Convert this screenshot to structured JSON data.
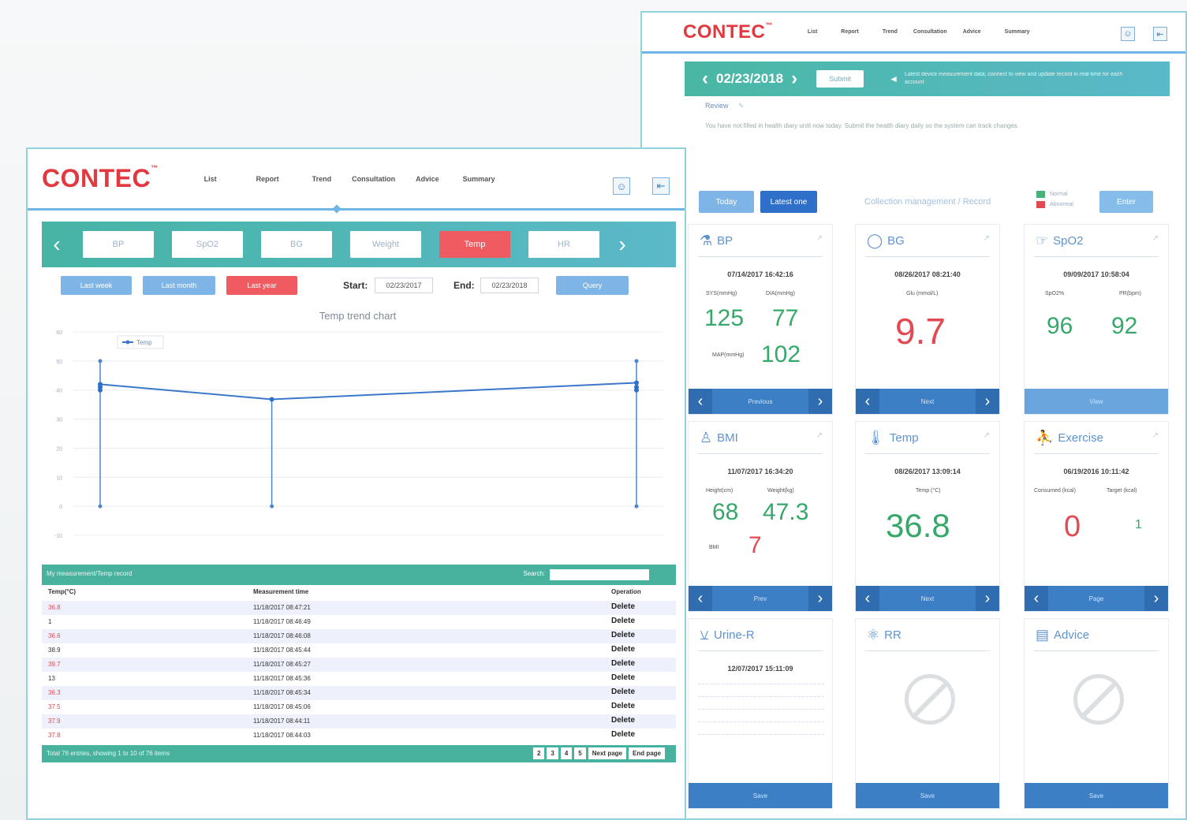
{
  "brand": {
    "logo": "CONTEC",
    "tm": "™",
    "logo_color": "#e2383f"
  },
  "colors": {
    "teal": "#49b29f",
    "accent_blue": "#2d6fc9",
    "red_value": "#e14a52",
    "green_value": "#35a86a",
    "active_tab": "#ef5b60"
  },
  "right_window": {
    "nav": [
      "List",
      "Report",
      "Trend",
      "Consultation",
      "Advice",
      "Summary"
    ],
    "header_icons": [
      "user-icon",
      "logout-icon"
    ],
    "date_bar": {
      "prev": "‹",
      "date": "02/23/2018",
      "next": "›",
      "button": "Submit",
      "note": "Latest device measurement data; connect to view and update record in real-time for each account"
    },
    "review": {
      "label": "Review",
      "text": "You have not filled in health diary until now today. Submit the health diary daily so the system can track changes."
    },
    "buttons": {
      "today": "Today",
      "latest": "Latest one",
      "collect": "Collection management / Record",
      "enter": "Enter"
    },
    "legend": [
      "Normal",
      "Abnormal"
    ],
    "cards": [
      {
        "title": "BP",
        "icon": "blood-pressure-icon",
        "timestamp": "07/14/2017 16:42:16",
        "labels": [
          "SYS(mmHg)",
          "DIA(mmHg)",
          "MAP(mmHg)"
        ],
        "values": [
          "125",
          "77",
          "102"
        ],
        "nav": "Previous"
      },
      {
        "title": "BG",
        "icon": "blood-glucose-icon",
        "timestamp": "08/26/2017 08:21:40",
        "labels": [
          "Glu (mmol/L)"
        ],
        "values": [
          "9.7"
        ],
        "nav": "Next"
      },
      {
        "title": "SpO2",
        "icon": "spo2-icon",
        "timestamp": "09/09/2017 10:58:04",
        "labels": [
          "SpO2%",
          "PR(bpm)"
        ],
        "values": [
          "96",
          "92"
        ],
        "nav": "View"
      },
      {
        "title": "BMI",
        "icon": "bmi-icon",
        "timestamp": "11/07/2017 16:34:20",
        "labels": [
          "Height(cm)",
          "Weight(kg)",
          "BMI"
        ],
        "values": [
          "68",
          "47.3",
          "7"
        ],
        "nav": "Prev"
      },
      {
        "title": "Temp",
        "icon": "thermometer-icon",
        "timestamp": "08/26/2017 13:09:14",
        "labels": [
          "Temp (°C)"
        ],
        "values": [
          "36.8"
        ],
        "nav": "Next"
      },
      {
        "title": "Exercise",
        "icon": "running-icon",
        "timestamp": "06/19/2016 10:11:42",
        "labels": [
          "Consumed (kcal)",
          "Target (kcal)"
        ],
        "values": [
          "0",
          "1"
        ],
        "nav": "Page"
      },
      {
        "title": "Urine-R",
        "icon": "urine-icon",
        "timestamp": "12/07/2017 15:11:09",
        "labels": [],
        "values": [],
        "nav": "Save"
      },
      {
        "title": "RR",
        "icon": "lungs-icon",
        "timestamp": "",
        "labels": [],
        "values": [],
        "nav": "Save"
      },
      {
        "title": "Advice",
        "icon": "clipboard-icon",
        "timestamp": "",
        "labels": [],
        "values": [],
        "nav": "Save"
      }
    ]
  },
  "left_window": {
    "nav": [
      "List",
      "Report",
      "Trend",
      "Consultation",
      "Advice",
      "Summary"
    ],
    "tabs": [
      "BP",
      "SpO2",
      "BG",
      "Weight",
      "Temp",
      "HR"
    ],
    "active_tab": "Temp",
    "range_buttons": [
      "Last week",
      "Last month",
      "Last year"
    ],
    "start_label": "Start:",
    "start_value": "02/23/2017",
    "end_label": "End:",
    "end_value": "02/23/2018",
    "query": "Query",
    "chart_title": "Temp trend chart",
    "table": {
      "title": "My measurement/Temp record",
      "search_label": "Search:",
      "columns": [
        "Temp(°C)",
        "Measurement time",
        "Operation"
      ],
      "rows": [
        {
          "temp": "36.8",
          "time": "11/18/2017 08:47:21",
          "op": "Delete"
        },
        {
          "temp": "1",
          "time": "11/18/2017 08:46:49",
          "op": "Delete"
        },
        {
          "temp": "36.6",
          "time": "11/18/2017 08:46:08",
          "op": "Delete"
        },
        {
          "temp": "38.9",
          "time": "11/18/2017 08:45:44",
          "op": "Delete"
        },
        {
          "temp": "39.7",
          "time": "11/18/2017 08:45:27",
          "op": "Delete"
        },
        {
          "temp": "13",
          "time": "11/18/2017 08:45:36",
          "op": "Delete"
        },
        {
          "temp": "36.3",
          "time": "11/18/2017 08:45:34",
          "op": "Delete"
        },
        {
          "temp": "37.5",
          "time": "11/18/2017 08:45:06",
          "op": "Delete"
        },
        {
          "temp": "37.9",
          "time": "11/18/2017 08:44:11",
          "op": "Delete"
        },
        {
          "temp": "37.8",
          "time": "11/18/2017 08:44:03",
          "op": "Delete"
        }
      ],
      "footer": "Total 76 entries, showing 1 to 10 of 76 items",
      "pages": [
        "2",
        "3",
        "4",
        "5",
        "Next page",
        "End page"
      ]
    }
  },
  "chart_data": {
    "type": "line",
    "title": "Temp trend chart",
    "series": [
      {
        "name": "Temp",
        "x": [
          0,
          0,
          0,
          0.32,
          1,
          1,
          1
        ],
        "values": [
          42,
          41,
          40,
          36.8,
          42.5,
          41,
          40
        ]
      }
    ],
    "yticks": [
      "60",
      "50",
      "40",
      "30",
      "20",
      "10",
      "0",
      "-10"
    ],
    "ylim": [
      -10,
      60
    ],
    "legend": "top-left",
    "grid": true
  }
}
